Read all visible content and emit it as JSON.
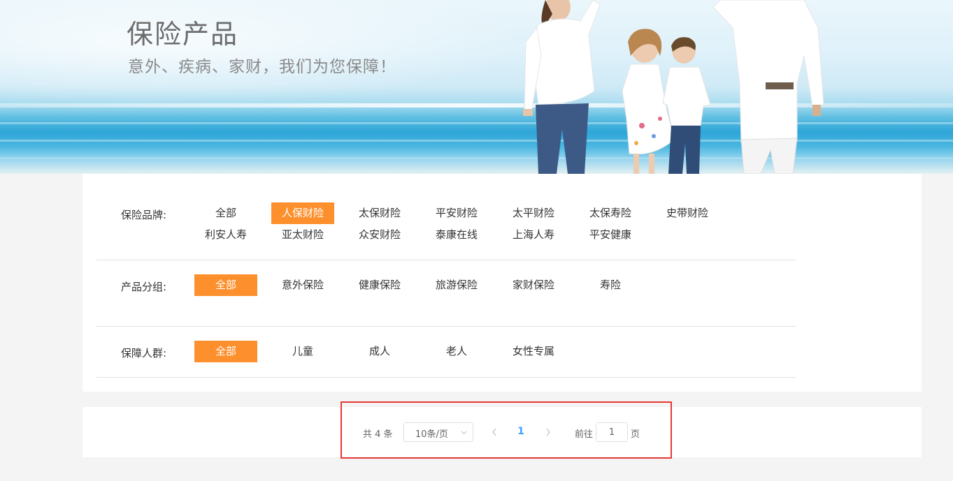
{
  "banner": {
    "title": "保险产品",
    "subtitle": "意外、疾病、家财，我们为您保障！"
  },
  "filters": {
    "brand": {
      "label": "保险品牌:",
      "options": [
        "全部",
        "人保财险",
        "太保财险",
        "平安财险",
        "太平财险",
        "太保寿险",
        "史带财险",
        "利安人寿",
        "亚太财险",
        "众安财险",
        "泰康在线",
        "上海人寿",
        "平安健康"
      ],
      "selected": "人保财险"
    },
    "group": {
      "label": "产品分组:",
      "options": [
        "全部",
        "意外保险",
        "健康保险",
        "旅游保险",
        "家财保险",
        "寿险"
      ],
      "selected": "全部"
    },
    "people": {
      "label": "保障人群:",
      "options": [
        "全部",
        "儿童",
        "成人",
        "老人",
        "女性专属"
      ],
      "selected": "全部"
    }
  },
  "pagination": {
    "total_text": "共 4 条",
    "page_size": "10条/页",
    "current_page": "1",
    "goto_prefix": "前往",
    "goto_value": "1",
    "goto_suffix": "页"
  },
  "colors": {
    "accent": "#fd8f2d",
    "page_active": "#409eff",
    "highlight_border": "#e53935"
  }
}
